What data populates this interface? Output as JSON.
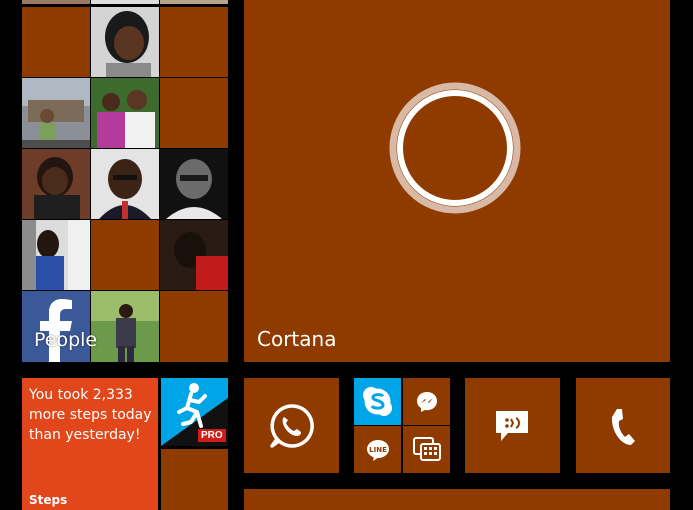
{
  "colors": {
    "accent": "#8f3b00",
    "steps_tile": "#e1471b",
    "background": "#000000",
    "skype": "#00a5e8"
  },
  "people_tile": {
    "label": "People"
  },
  "cortana_tile": {
    "label": "Cortana"
  },
  "steps_tile": {
    "message": "You took 2,333 more steps today than yesterday!",
    "label": "Steps"
  },
  "runner_tile": {
    "badge": "PRO"
  },
  "icons": [
    "whatsapp-icon",
    "skype-icon",
    "messenger-icon",
    "line-icon",
    "bbm-icon",
    "messaging-icon",
    "phone-icon",
    "facebook-icon",
    "runner-icon",
    "cortana-ring-icon"
  ]
}
